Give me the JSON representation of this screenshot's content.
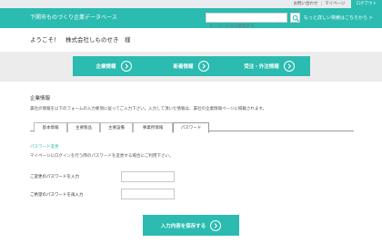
{
  "topbar": {
    "links": [
      "お問い合わせ",
      "マイページ"
    ],
    "separator": "|",
    "logout": "ログアウト"
  },
  "header": {
    "site_title": "下関市ものづくり企業データベース",
    "search_placeholder": "キーワードから検索する",
    "detail_search_link": "もっと詳しい検索はこちらから >"
  },
  "welcome": "ようこそ！　株式会社しものせき　様",
  "nav": {
    "buttons": [
      "企業情報",
      "新着情報",
      "受注・外注情報"
    ]
  },
  "section": {
    "title": "企業情報",
    "description": "貴社の情報を以下のフォームの入力要項に従ってご入力下さい。入力して頂いた情報は、貴社の企業情報ページに掲載されます。"
  },
  "tabs": [
    "基本情報",
    "主要製品",
    "主要設備",
    "事業所情報",
    "パスワード"
  ],
  "password": {
    "title": "パスワード変更",
    "description": "マイページにログインを行う際のパスワードを変更する場合にご利用下さい。",
    "current_label": "ご変更のパスワードを入力",
    "confirm_label": "ご希望のパスワードを再入力",
    "current_value": "",
    "confirm_value": ""
  },
  "save_label": "入力内容を保存する",
  "colors": {
    "accent": "#2bbbb0",
    "band": "#ececec",
    "topbar": "#e9ecef"
  }
}
